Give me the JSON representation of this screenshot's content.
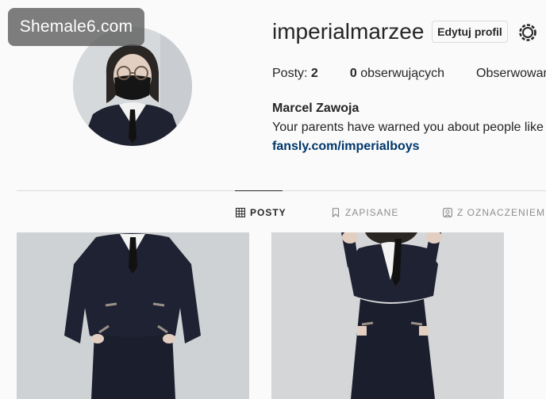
{
  "watermark": "Shemale6.com",
  "profile": {
    "username": "imperialmarzee",
    "edit_button": "Edytuj profil",
    "full_name": "Marcel Zawoja",
    "bio": "Your parents have warned you about people like me",
    "link": "fansly.com/imperialboys"
  },
  "stats": {
    "posts_label": "Posty:",
    "posts_count": "2",
    "followers_count": "0",
    "followers_label": "obserwujących",
    "following_label": "Obserwowani"
  },
  "tabs": [
    {
      "label": "POSTY",
      "icon": "grid-icon",
      "active": true
    },
    {
      "label": "ZAPISANE",
      "icon": "bookmark-icon",
      "active": false
    },
    {
      "label": "Z OZNACZENIEM",
      "icon": "tagged-icon",
      "active": false
    }
  ],
  "icons": {
    "settings": "gear-icon"
  },
  "colors": {
    "background": "#fafafa",
    "text": "#262626",
    "link": "#00376b",
    "muted": "#8e8e8e",
    "border": "#dbdbdb"
  }
}
